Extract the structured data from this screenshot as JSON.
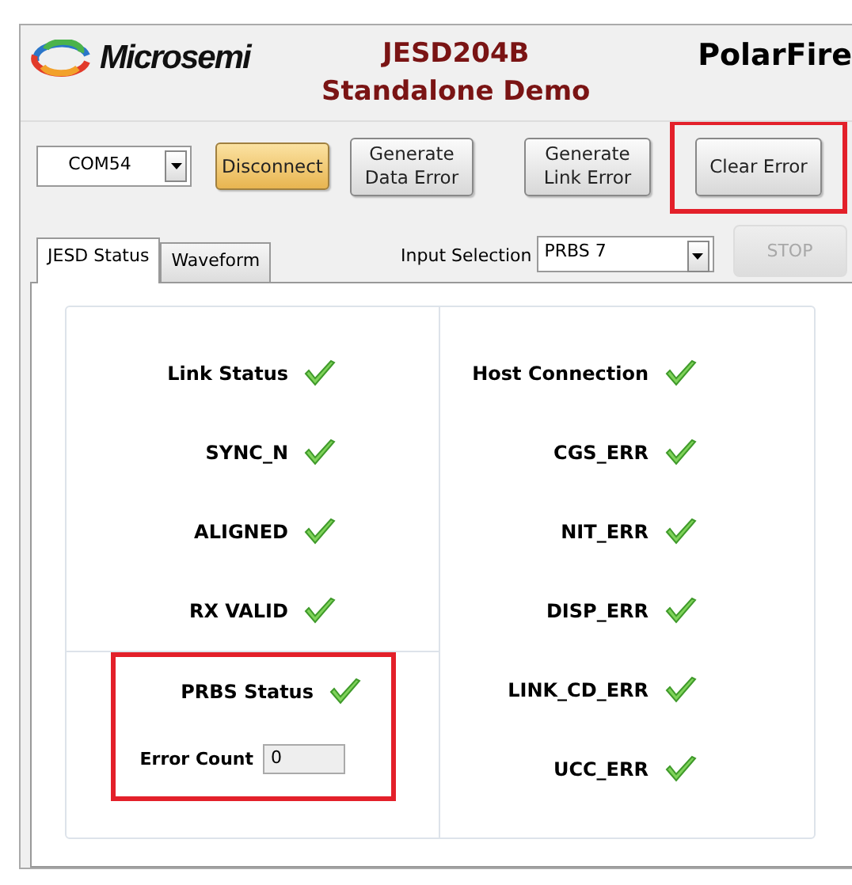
{
  "header": {
    "logo_text": "Microsemi",
    "title": "JESD204B",
    "subtitle": "Standalone Demo",
    "product": "PolarFire"
  },
  "toolbar": {
    "port": {
      "value": "COM54"
    },
    "buttons": [
      {
        "label": "Disconnect",
        "kind": "primary",
        "highlighted": false
      },
      {
        "label": "Generate\nData Error",
        "kind": "normal",
        "highlighted": false
      },
      {
        "label": "Generate\nLink Error",
        "kind": "normal",
        "highlighted": false
      },
      {
        "label": "Clear Error",
        "kind": "normal",
        "highlighted": true
      }
    ]
  },
  "tabs": [
    {
      "label": "JESD Status",
      "selected": true
    },
    {
      "label": "Waveform",
      "selected": false
    }
  ],
  "input_selection": {
    "label": "Input Selection",
    "value": "PRBS 7"
  },
  "stop_button": {
    "label": "STOP",
    "disabled": true
  },
  "status": {
    "left": [
      {
        "label": "Link Status",
        "ok": true
      },
      {
        "label": "SYNC_N",
        "ok": true
      },
      {
        "label": "ALIGNED",
        "ok": true
      },
      {
        "label": "RX VALID",
        "ok": true
      }
    ],
    "prbs": {
      "highlighted": true,
      "status": {
        "label": "PRBS Status",
        "ok": true
      },
      "error_count": {
        "label": "Error Count",
        "value": "0"
      }
    },
    "right": [
      {
        "label": "Host Connection",
        "ok": true
      },
      {
        "label": "CGS_ERR",
        "ok": true
      },
      {
        "label": "NIT_ERR",
        "ok": true
      },
      {
        "label": "DISP_ERR",
        "ok": true
      },
      {
        "label": "LINK_CD_ERR",
        "ok": true
      },
      {
        "label": "UCC_ERR",
        "ok": true
      }
    ]
  }
}
